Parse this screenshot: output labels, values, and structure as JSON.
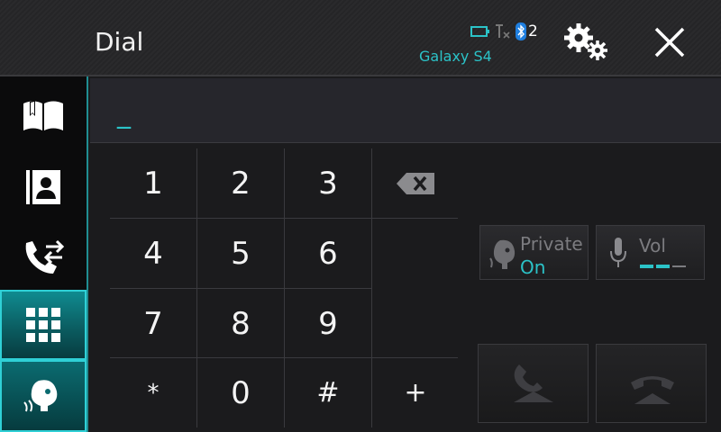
{
  "header": {
    "title": "Dial",
    "device_name": "Galaxy S4",
    "bt_count": "2"
  },
  "sidebar": {
    "items": [
      {
        "name": "phonebook-icon"
      },
      {
        "name": "contacts-icon"
      },
      {
        "name": "call-history-icon"
      },
      {
        "name": "keypad-icon",
        "active": true
      },
      {
        "name": "voice-recognition-icon"
      }
    ]
  },
  "display": {
    "value": "_"
  },
  "keypad": {
    "keys": [
      "1",
      "2",
      "3",
      "4",
      "5",
      "6",
      "7",
      "8",
      "9",
      "*",
      "0",
      "#",
      "+"
    ]
  },
  "buttons": {
    "private_label": "Private",
    "private_value": "On",
    "vol_label": "Vol",
    "vol_level": 0.66
  },
  "colors": {
    "accent": "#2bc3c8",
    "muted": "#7c7c80"
  }
}
